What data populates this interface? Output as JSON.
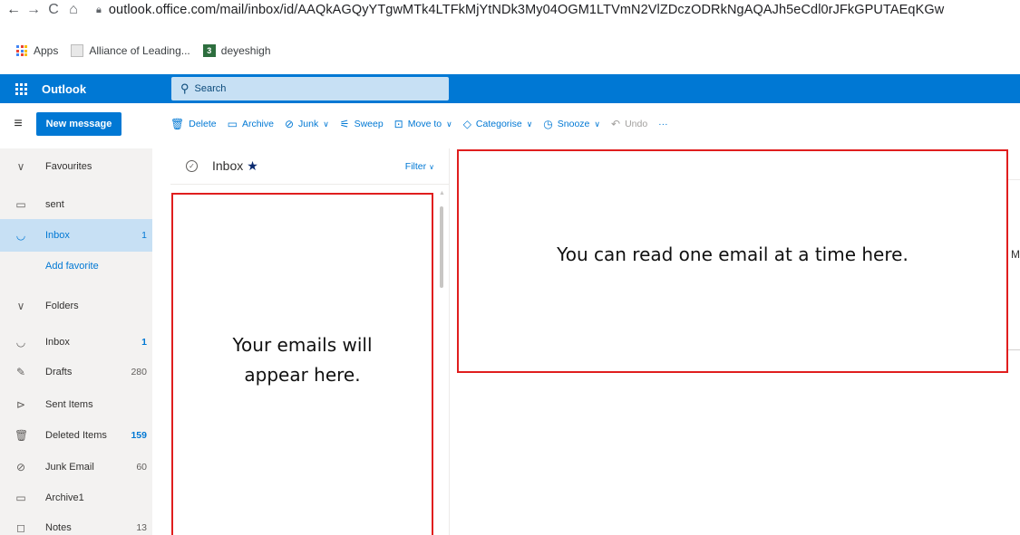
{
  "browser": {
    "url": "outlook.office.com/mail/inbox/id/AAQkAGQyYTgwMTk4LTFkMjYtNDk3My04OGM1LTVmN2VlZDczODRkNgAQAJh5eCdl0rJFkGPUTAEqKGw",
    "bookmarks": [
      {
        "label": "Apps"
      },
      {
        "label": "Alliance of Leading..."
      },
      {
        "label": "deyeshigh"
      }
    ]
  },
  "header": {
    "app_name": "Outlook",
    "search_placeholder": "Search"
  },
  "commandbar": {
    "new_message": "New message",
    "delete": "Delete",
    "archive": "Archive",
    "junk": "Junk",
    "sweep": "Sweep",
    "move_to": "Move to",
    "categorise": "Categorise",
    "snooze": "Snooze",
    "undo": "Undo",
    "more": "···"
  },
  "leftnav": {
    "favourites": "Favourites",
    "fav_items": [
      {
        "label": "sent",
        "count": ""
      },
      {
        "label": "Inbox",
        "count": "1"
      }
    ],
    "add_favorite": "Add favorite",
    "folders": "Folders",
    "folder_items": [
      {
        "label": "Inbox",
        "count": "1"
      },
      {
        "label": "Drafts",
        "count": "280"
      },
      {
        "label": "Sent Items",
        "count": ""
      },
      {
        "label": "Deleted Items",
        "count": "159"
      },
      {
        "label": "Junk Email",
        "count": "60"
      },
      {
        "label": "Archive1",
        "count": ""
      },
      {
        "label": "Notes",
        "count": "13"
      }
    ]
  },
  "msglist": {
    "title": "Inbox",
    "star": "★",
    "filter": "Filter"
  },
  "readpane": {
    "edge_text": "M"
  },
  "annotations": {
    "list_line1": "Your emails will",
    "list_line2": "appear here.",
    "read": "You can read one email at a time here."
  },
  "colors": {
    "brand_blue": "#0078d4",
    "search_bg": "#c7e0f4",
    "annotation_red": "#e01e1e"
  }
}
